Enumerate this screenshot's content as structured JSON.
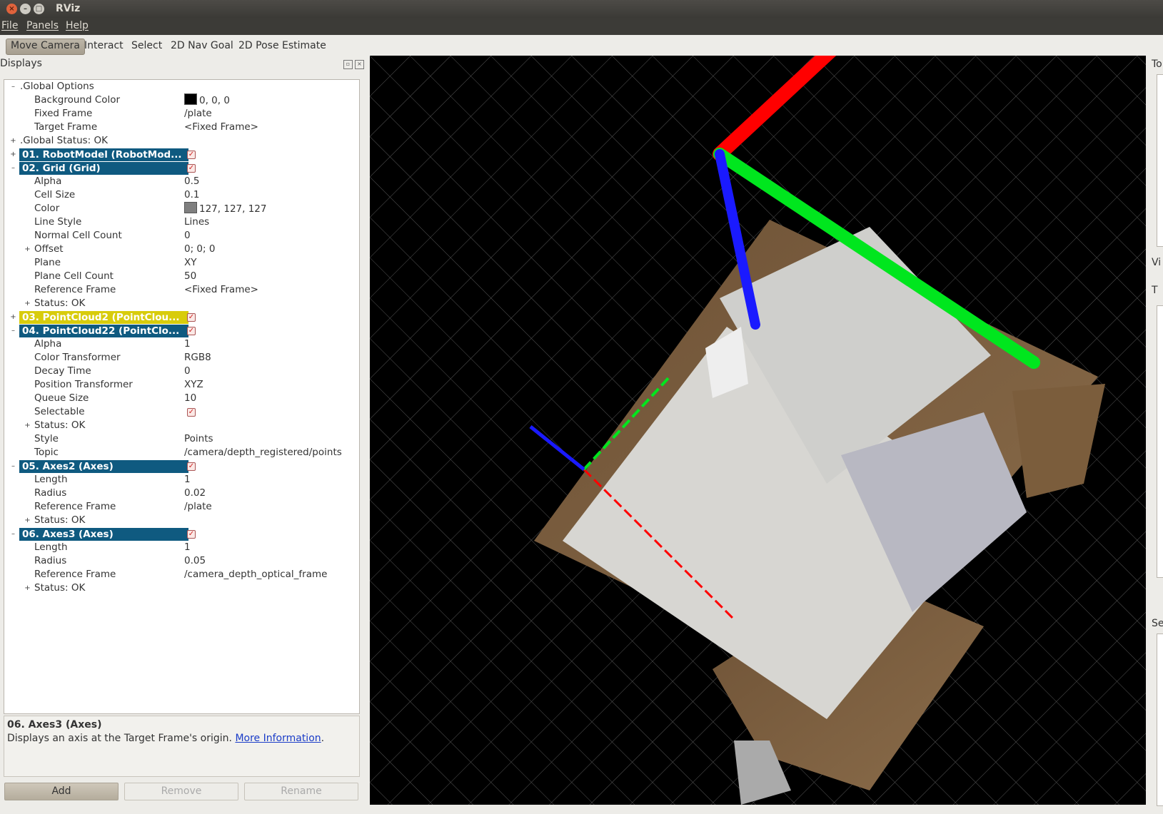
{
  "window": {
    "title": "RViz"
  },
  "menu": [
    "File",
    "Panels",
    "Help"
  ],
  "tools": [
    "Move Camera",
    "Interact",
    "Select",
    "2D Nav Goal",
    "2D Pose Estimate"
  ],
  "displays_panel": {
    "title": "Displays",
    "rows": [
      {
        "label": ".Global Options",
        "expander": "–",
        "indent": 0
      },
      {
        "label": "Background Color",
        "value": "0, 0, 0",
        "swatch": "#000000",
        "indent": 2
      },
      {
        "label": "Fixed Frame",
        "value": "/plate",
        "indent": 2
      },
      {
        "label": "Target Frame",
        "value": "<Fixed Frame>",
        "indent": 2
      },
      {
        "label": ".Global Status: OK",
        "expander": "+",
        "indent": 0
      },
      {
        "label": "01. RobotModel (RobotMod...",
        "expander": "+",
        "header": "blue",
        "checked": true
      },
      {
        "label": "02. Grid (Grid)",
        "expander": "–",
        "header": "blue",
        "checked": true
      },
      {
        "label": "Alpha",
        "value": "0.5",
        "indent": 2
      },
      {
        "label": "Cell Size",
        "value": "0.1",
        "indent": 2
      },
      {
        "label": "Color",
        "value": "127, 127, 127",
        "swatch": "#7f7f7f",
        "indent": 2
      },
      {
        "label": "Line Style",
        "value": "Lines",
        "indent": 2
      },
      {
        "label": "Normal Cell Count",
        "value": "0",
        "indent": 2
      },
      {
        "label": "Offset",
        "value": "0; 0; 0",
        "expander": "+",
        "indent": 2
      },
      {
        "label": "Plane",
        "value": "XY",
        "indent": 2
      },
      {
        "label": "Plane Cell Count",
        "value": "50",
        "indent": 2
      },
      {
        "label": "Reference Frame",
        "value": "<Fixed Frame>",
        "indent": 2
      },
      {
        "label": "Status: OK",
        "expander": "+",
        "indent": 2
      },
      {
        "label": "03. PointCloud2 (PointClou...",
        "expander": "+",
        "header": "yellow",
        "checked": true
      },
      {
        "label": "04. PointCloud22 (PointClo...",
        "expander": "–",
        "header": "blue",
        "checked": true
      },
      {
        "label": "Alpha",
        "value": "1",
        "indent": 2
      },
      {
        "label": "Color Transformer",
        "value": "RGB8",
        "indent": 2
      },
      {
        "label": "Decay Time",
        "value": "0",
        "indent": 2
      },
      {
        "label": "Position Transformer",
        "value": "XYZ",
        "indent": 2
      },
      {
        "label": "Queue Size",
        "value": "10",
        "indent": 2
      },
      {
        "label": "Selectable",
        "checkbox_value": true,
        "indent": 2
      },
      {
        "label": "Status: OK",
        "expander": "+",
        "indent": 2
      },
      {
        "label": "Style",
        "value": "Points",
        "indent": 2
      },
      {
        "label": "Topic",
        "value": "/camera/depth_registered/points",
        "indent": 2
      },
      {
        "label": "05. Axes2 (Axes)",
        "expander": "–",
        "header": "blue",
        "checked": true
      },
      {
        "label": "Length",
        "value": "1",
        "indent": 2
      },
      {
        "label": "Radius",
        "value": "0.02",
        "indent": 2
      },
      {
        "label": "Reference Frame",
        "value": "/plate",
        "indent": 2
      },
      {
        "label": "Status: OK",
        "expander": "+",
        "indent": 2
      },
      {
        "label": "06. Axes3 (Axes)",
        "expander": "–",
        "header": "blue",
        "checked": true
      },
      {
        "label": "Length",
        "value": "1",
        "indent": 2
      },
      {
        "label": "Radius",
        "value": "0.05",
        "indent": 2
      },
      {
        "label": "Reference Frame",
        "value": "/camera_depth_optical_frame",
        "indent": 2
      },
      {
        "label": "Status: OK",
        "expander": "+",
        "indent": 2
      }
    ]
  },
  "description": {
    "title": "06. Axes3 (Axes)",
    "text": "Displays an axis at the Target Frame's origin.",
    "link": "More Information",
    "suffix": "."
  },
  "buttons": {
    "add": "Add",
    "remove": "Remove",
    "rename": "Rename"
  },
  "right_panel_labels": [
    "To",
    "Vi",
    "T",
    "Se"
  ],
  "colors": {
    "axis_x": "#ff0000",
    "axis_y": "#00ff00",
    "axis_z": "#0000ff",
    "header_blue": "#0f5a80",
    "header_yellow": "#d8cc0c"
  }
}
